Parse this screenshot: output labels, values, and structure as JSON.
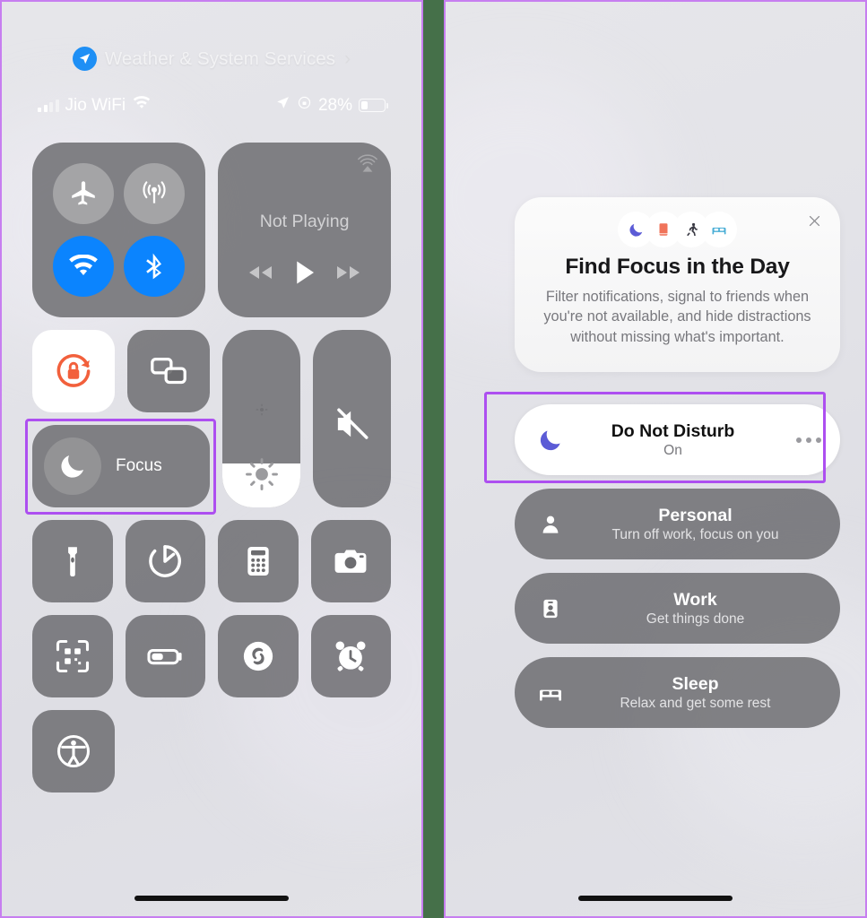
{
  "left_panel": {
    "weather_banner": {
      "icon": "location-arrow-icon",
      "label": "Weather & System Services",
      "chevron": "›"
    },
    "status_bar": {
      "signal_icon": "cellular-bars-icon",
      "carrier": "Jio WiFi",
      "wifi_icon": "wifi-icon",
      "location_icon": "location-arrow-icon",
      "orientation_lock_icon": "rotation-lock-icon",
      "battery_percent": "28%",
      "battery_icon": "battery-icon"
    },
    "connectivity": {
      "airplane": {
        "name": "airplane-mode-toggle",
        "icon": "airplane-icon",
        "state": "off"
      },
      "cellular": {
        "name": "cellular-data-toggle",
        "icon": "cellular-antenna-icon",
        "state": "off"
      },
      "wifi": {
        "name": "wifi-toggle",
        "icon": "wifi-icon",
        "state": "on"
      },
      "bluetooth": {
        "name": "bluetooth-toggle",
        "icon": "bluetooth-icon",
        "state": "on"
      }
    },
    "media": {
      "airplay_icon": "airplay-icon",
      "status": "Not Playing",
      "prev_icon": "rewind-icon",
      "play_icon": "play-icon",
      "next_icon": "fast-forward-icon"
    },
    "rotation_lock": {
      "icon": "rotation-lock-icon",
      "state": "on"
    },
    "screen_mirroring": {
      "icon": "screen-mirroring-icon"
    },
    "focus_tile": {
      "icon": "moon-icon",
      "label": "Focus"
    },
    "brightness": {
      "icon": "brightness-icon",
      "level_percent": 25
    },
    "volume": {
      "icon": "speaker-mute-icon",
      "level_percent": 0
    },
    "shortcuts": [
      {
        "name": "flashlight-button",
        "icon": "flashlight-icon"
      },
      {
        "name": "timer-button",
        "icon": "timer-icon"
      },
      {
        "name": "calculator-button",
        "icon": "calculator-icon"
      },
      {
        "name": "camera-button",
        "icon": "camera-icon"
      },
      {
        "name": "qr-scanner-button",
        "icon": "qr-code-icon"
      },
      {
        "name": "low-power-mode-button",
        "icon": "battery-low-icon"
      },
      {
        "name": "shazam-button",
        "icon": "shazam-icon"
      },
      {
        "name": "alarm-button",
        "icon": "alarm-clock-icon"
      },
      {
        "name": "accessibility-button",
        "icon": "accessibility-icon"
      }
    ]
  },
  "right_panel": {
    "promo_card": {
      "icons": [
        "moon-icon",
        "book-icon",
        "running-person-icon",
        "bed-icon"
      ],
      "close_icon": "close-icon",
      "title": "Find Focus in the Day",
      "description": "Filter notifications, signal to friends when you're not available, and hide distractions without missing what's important."
    },
    "active_focus": {
      "icon": "moon-icon",
      "title": "Do Not Disturb",
      "subtitle": "On",
      "more_icon": "ellipsis-icon"
    },
    "focus_modes": [
      {
        "icon": "person-icon",
        "title": "Personal",
        "subtitle": "Turn off work, focus on you"
      },
      {
        "icon": "id-badge-icon",
        "title": "Work",
        "subtitle": "Get things done"
      },
      {
        "icon": "bed-icon",
        "title": "Sleep",
        "subtitle": "Relax and get some rest"
      }
    ]
  },
  "annotations": {
    "highlight_color": "#ad4ff0",
    "divider_color": "#457049"
  },
  "colors": {
    "accent_blue": "#0b84fe",
    "tile_grey": "#696c6c",
    "focus_purple": "#5b5bd6",
    "book_orange": "#f0735a",
    "bed_blue": "#4aaed6",
    "rotation_lock_orange": "#f2603c"
  }
}
